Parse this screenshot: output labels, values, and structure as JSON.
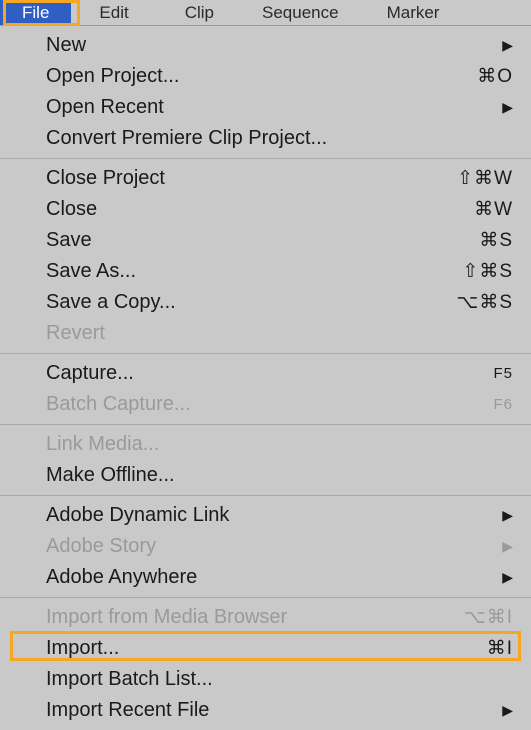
{
  "menubar": {
    "items": [
      {
        "label": "File",
        "selected": true
      },
      {
        "label": "Edit"
      },
      {
        "label": "Clip"
      },
      {
        "label": "Sequence"
      },
      {
        "label": "Marker"
      }
    ]
  },
  "menu": {
    "groups": [
      [
        {
          "label": "New",
          "submenu": true
        },
        {
          "label": "Open Project...",
          "shortcut": "⌘O"
        },
        {
          "label": "Open Recent",
          "submenu": true
        },
        {
          "label": "Convert Premiere Clip Project..."
        }
      ],
      [
        {
          "label": "Close Project",
          "shortcut": "⇧⌘W"
        },
        {
          "label": "Close",
          "shortcut": "⌘W"
        },
        {
          "label": "Save",
          "shortcut": "⌘S"
        },
        {
          "label": "Save As...",
          "shortcut": "⇧⌘S"
        },
        {
          "label": "Save a Copy...",
          "shortcut": "⌥⌘S"
        },
        {
          "label": "Revert",
          "disabled": true
        }
      ],
      [
        {
          "label": "Capture...",
          "shortcut": "F5",
          "fkey": true
        },
        {
          "label": "Batch Capture...",
          "shortcut": "F6",
          "fkey": true,
          "disabled": true
        }
      ],
      [
        {
          "label": "Link Media...",
          "disabled": true
        },
        {
          "label": "Make Offline..."
        }
      ],
      [
        {
          "label": "Adobe Dynamic Link",
          "submenu": true
        },
        {
          "label": "Adobe Story",
          "submenu": true,
          "disabled": true
        },
        {
          "label": "Adobe Anywhere",
          "submenu": true
        }
      ],
      [
        {
          "label": "Import from Media Browser",
          "shortcut": "⌥⌘I",
          "disabled": true
        },
        {
          "label": "Import...",
          "shortcut": "⌘I",
          "highlighted": true
        },
        {
          "label": "Import Batch List..."
        },
        {
          "label": "Import Recent File",
          "submenu": true
        }
      ]
    ]
  }
}
